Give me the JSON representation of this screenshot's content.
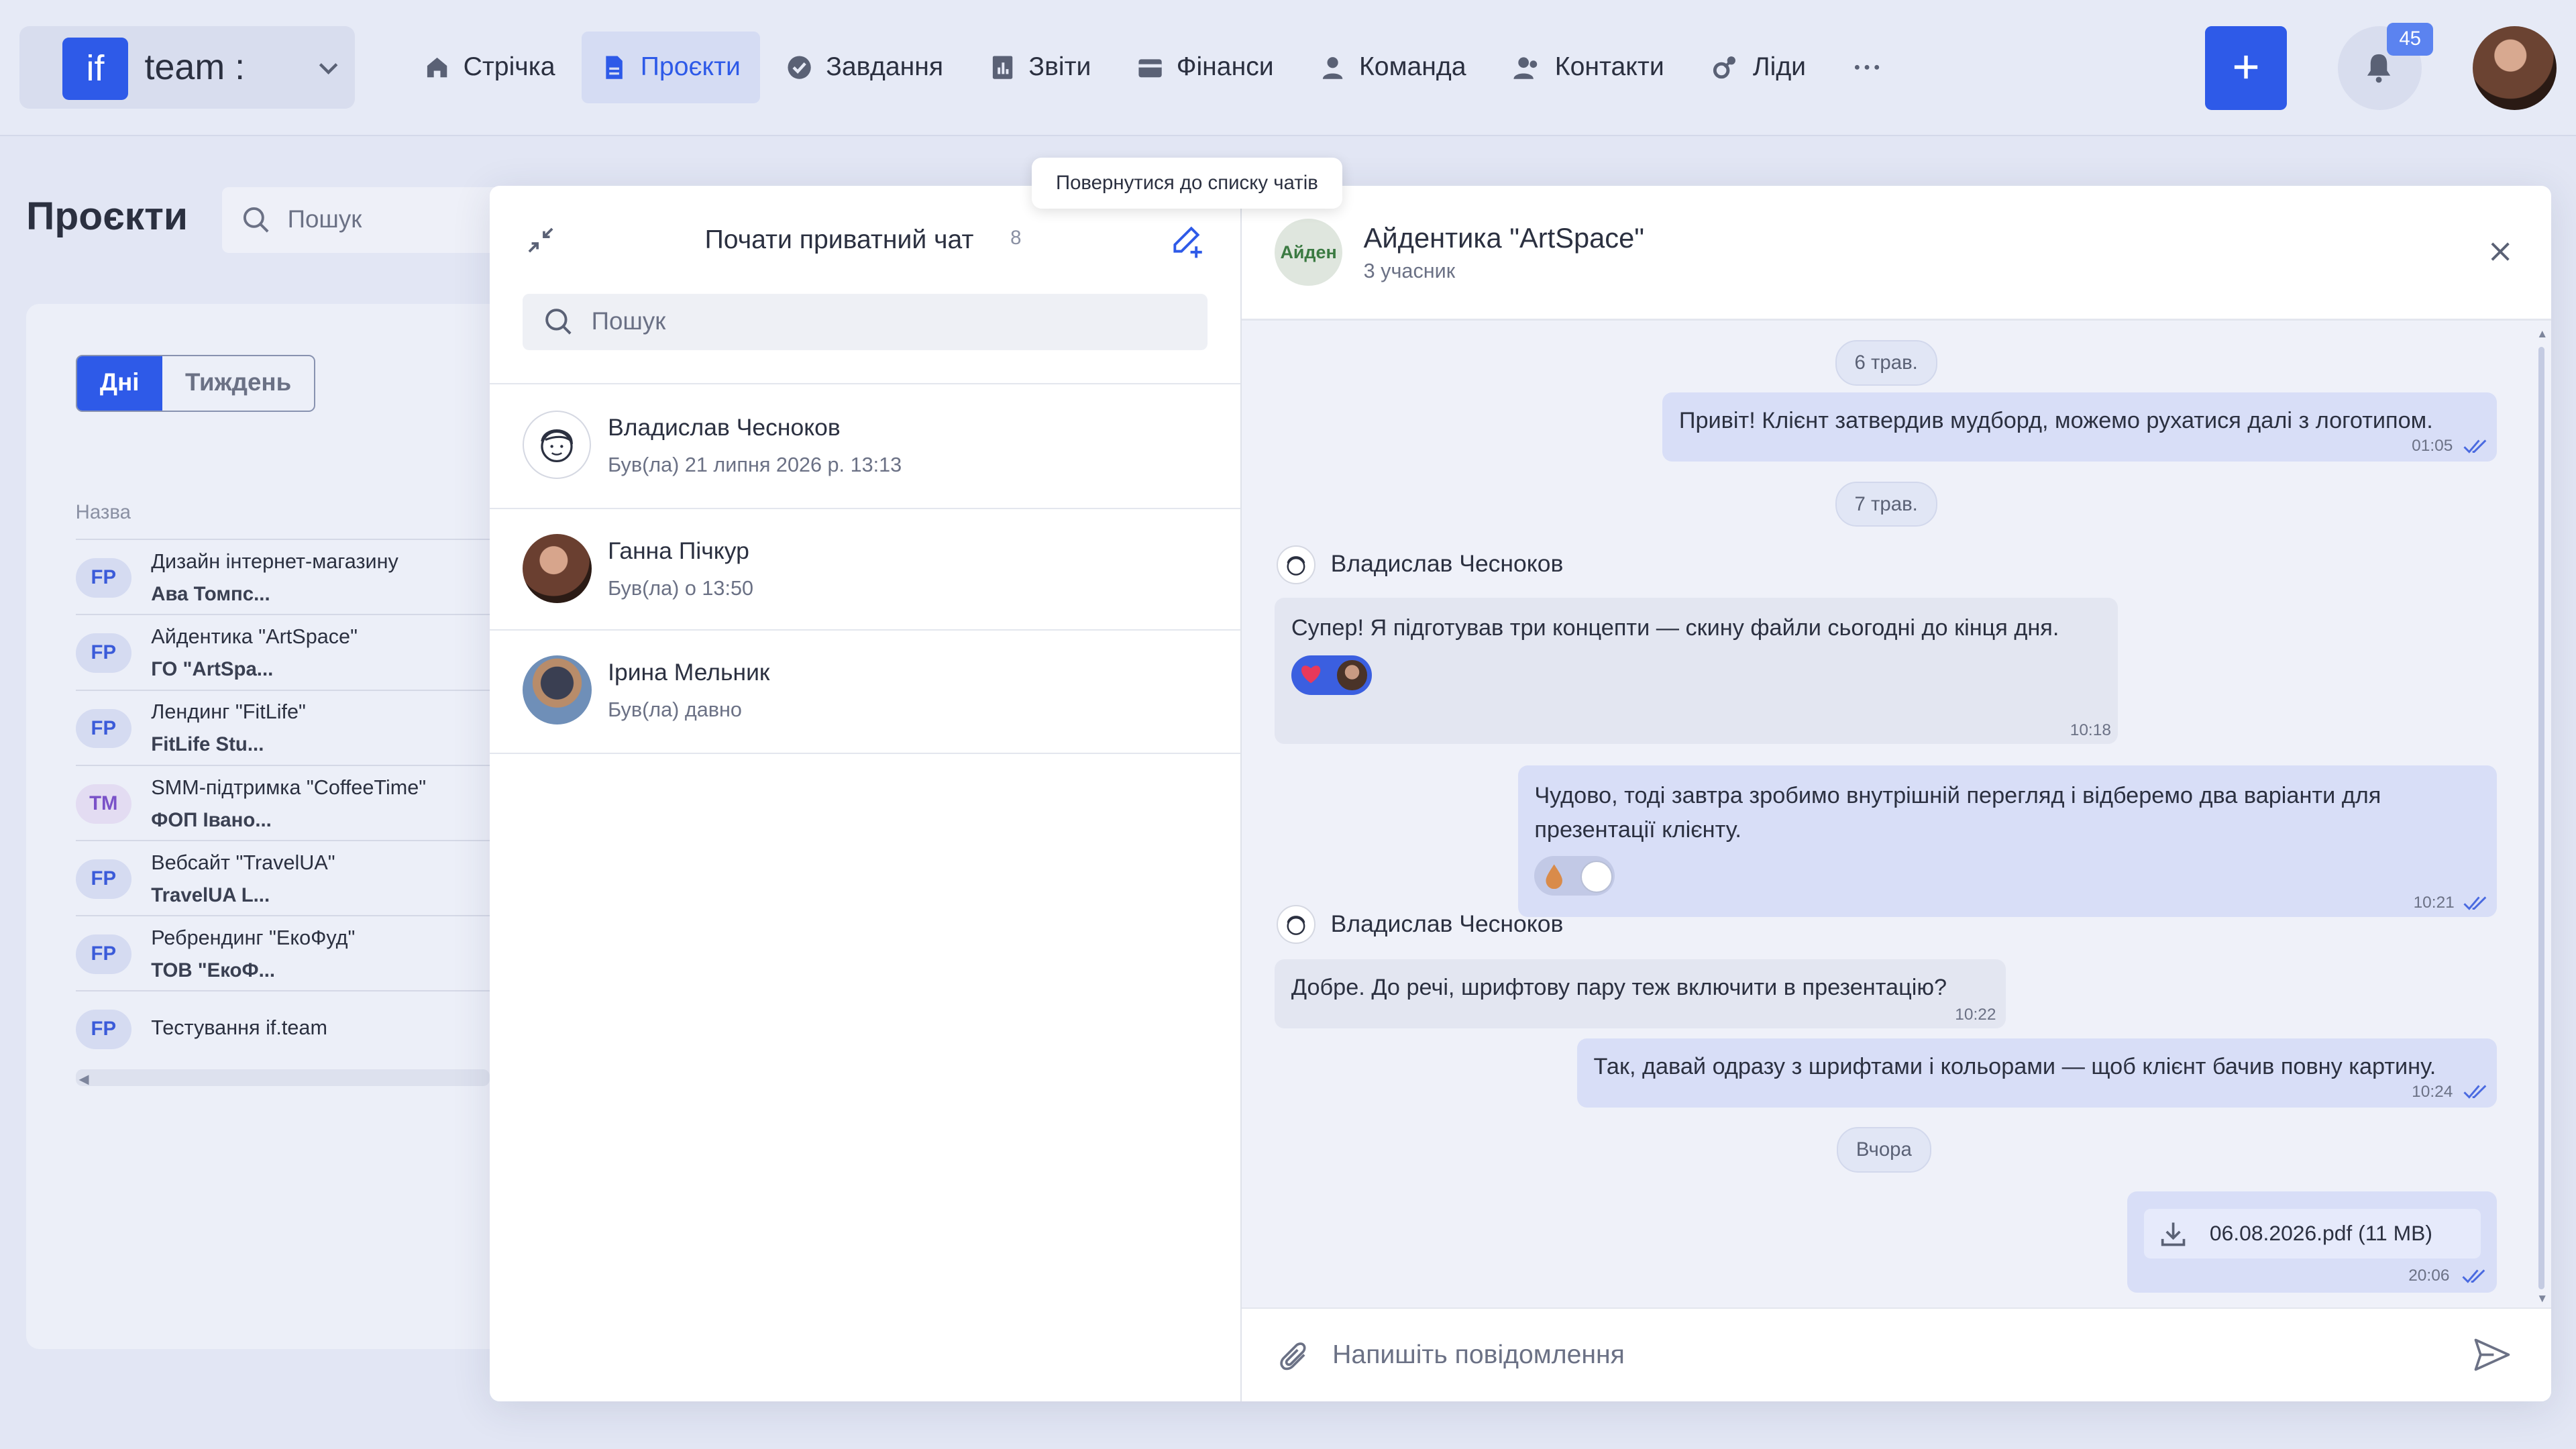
{
  "brand": {
    "logo": "if",
    "name": "team :"
  },
  "nav": [
    {
      "label": "Стрічка",
      "icon": "home-icon"
    },
    {
      "label": "Проєкти",
      "icon": "document-icon",
      "active": true
    },
    {
      "label": "Завдання",
      "icon": "check-circle-icon"
    },
    {
      "label": "Звіти",
      "icon": "report-icon"
    },
    {
      "label": "Фінанси",
      "icon": "wallet-icon"
    },
    {
      "label": "Команда",
      "icon": "user-icon"
    },
    {
      "label": "Контакти",
      "icon": "contacts-icon"
    },
    {
      "label": "Ліди",
      "icon": "leads-icon"
    }
  ],
  "notifications": {
    "count": "45"
  },
  "page": {
    "title": "Проєкти",
    "search_placeholder": "Пошук",
    "tabs": {
      "days": "Дні",
      "week": "Тиждень"
    },
    "column_name": "Назва",
    "projects": [
      {
        "tag": "FP",
        "title": "Дизайн інтернет-магазину",
        "client": "Ава Томпс..."
      },
      {
        "tag": "FP",
        "title": "Айдентика \"ArtSpace\"",
        "client": "ГО \"ArtSpa..."
      },
      {
        "tag": "FP",
        "title": "Лендинг \"FitLife\"",
        "client": "FitLife Stu..."
      },
      {
        "tag": "TM",
        "title": "SMM-підтримка \"CoffeeTime\"",
        "client": "ФОП Івано..."
      },
      {
        "tag": "FP",
        "title": "Вебсайт \"TravelUA\"",
        "client": "TravelUA L..."
      },
      {
        "tag": "FP",
        "title": "Ребрендинг \"ЕкоФуд\"",
        "client": "ТОВ \"ЕкоФ..."
      },
      {
        "tag": "FP",
        "title": "Тестування if.team",
        "client": ""
      }
    ]
  },
  "chat_list": {
    "title": "Почати приватний чат",
    "count": "8",
    "search_placeholder": "Пошук",
    "tooltip": "Повернутися до списку чатів",
    "chats": [
      {
        "name": "Владислав Чесноков",
        "status": "Був(ла) 21 липня 2026 р. 13:13"
      },
      {
        "name": "Ганна Пічкур",
        "status": "Був(ла) о 13:50"
      },
      {
        "name": "Ірина Мельник",
        "status": "Був(ла) давно"
      }
    ]
  },
  "conversation": {
    "avatar_text": "Айден",
    "title": "Айдентика \"ArtSpace\"",
    "subtitle": "3 учасник",
    "input_placeholder": "Напишіть повідомлення",
    "dates": [
      "6 трав.",
      "7 трав.",
      "Вчора"
    ],
    "messages": [
      {
        "dir": "out",
        "text": "Привіт! Клієнт затвердив мудборд, можемо рухатися далі з логотипом.",
        "time": "01:05"
      },
      {
        "dir": "in",
        "sender": "Владислав Чесноков",
        "text": "Супер! Я підготував три концепти — скину файли сьогодні до кінця дня.",
        "time": "10:18"
      },
      {
        "dir": "out",
        "text_line1": "Чудово, тоді завтра зробимо внутрішній перегляд і відберемо два варіанти для",
        "text_line2": "презентації клієнту.",
        "time": "10:21"
      },
      {
        "dir": "in",
        "sender": "Владислав Чесноков",
        "text": "Добре. До речі, шрифтову пару теж включити в презентацію?",
        "time": "10:22"
      },
      {
        "dir": "out",
        "text": "Так, давай одразу з шрифтами і кольорами — щоб клієнт бачив повну картину.",
        "time": "10:24"
      },
      {
        "dir": "out",
        "file": "06.08.2026.pdf (11 MB)",
        "time": "20:06"
      }
    ]
  },
  "colors": {
    "accent": "#2e5ae8",
    "background": "#e2e6f4",
    "bubble_out": "#d8def7",
    "bubble_in": "#e3e6f1"
  }
}
